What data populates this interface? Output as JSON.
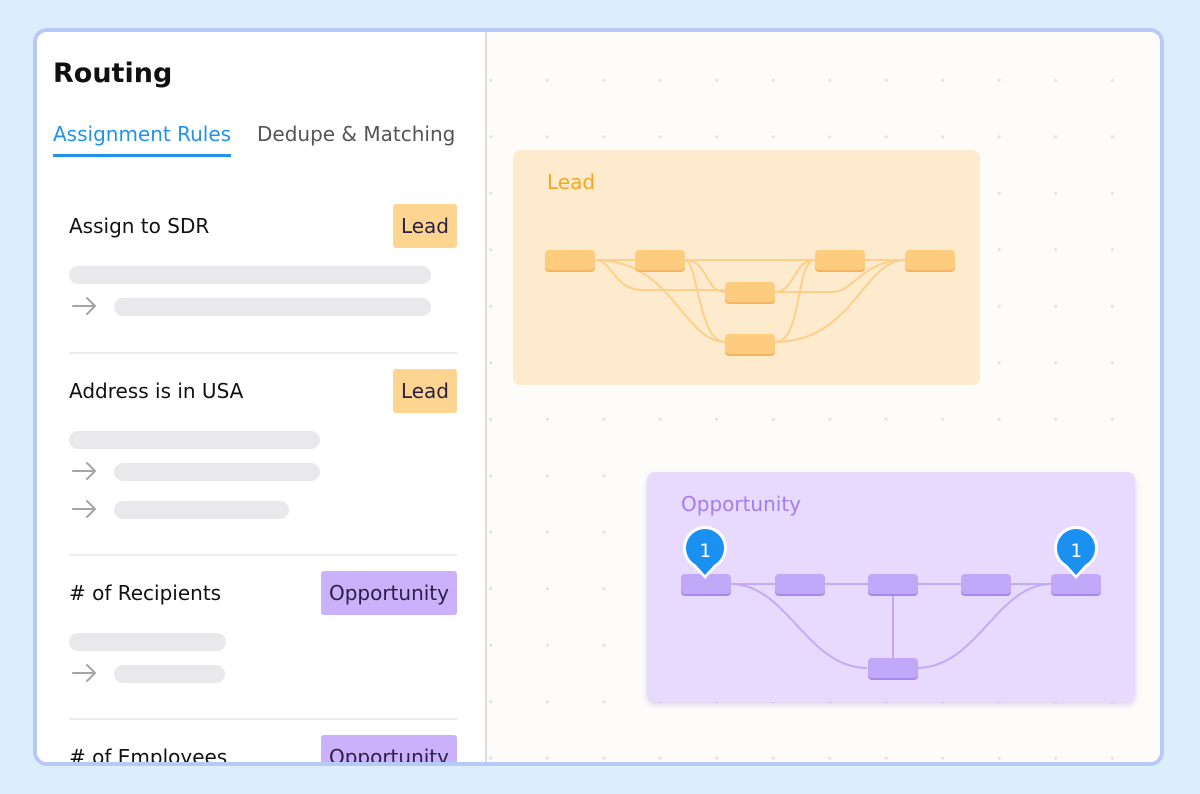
{
  "routing": {
    "title": "Routing",
    "tabs": [
      {
        "label": "Assignment Rules",
        "active": true
      },
      {
        "label": "Dedupe & Matching",
        "active": false
      }
    ],
    "rules": [
      {
        "title": "Assign to SDR",
        "badge": "Lead"
      },
      {
        "title": "Address is in USA",
        "badge": "Lead"
      },
      {
        "title": "# of Recipients",
        "badge": "Opportunity"
      },
      {
        "title": "# of Employees",
        "badge": "Opportunity"
      }
    ]
  },
  "canvas": {
    "groups": [
      {
        "label": "Lead",
        "color": "#f6a623"
      },
      {
        "label": "Opportunity",
        "color": "#a57cf2"
      }
    ],
    "pins": [
      {
        "label": "1",
        "color": "#1a90f0"
      },
      {
        "label": "1",
        "color": "#1a90f0"
      }
    ]
  },
  "colors": {
    "accent": "#2193ee",
    "lead_badge": "#fdd490",
    "opportunity_badge": "#cbb0fb",
    "page_background": "#dcedfc"
  }
}
